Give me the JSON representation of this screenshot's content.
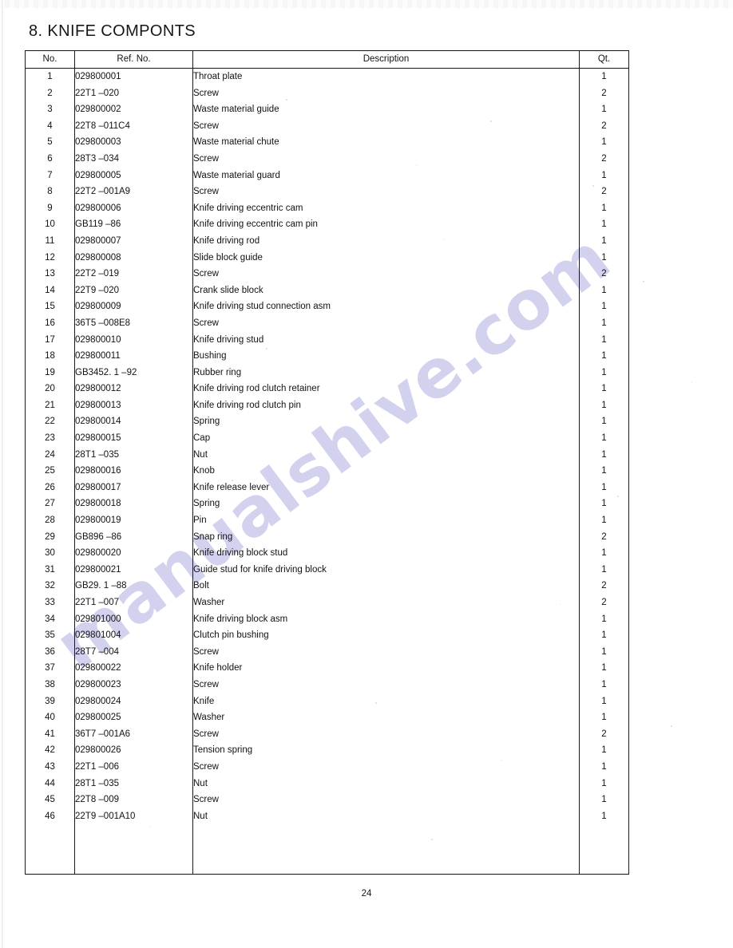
{
  "document": {
    "title": "8. KNIFE COMPONTS",
    "page_number": "24",
    "watermark": "manualshive.com",
    "watermark_color": "#c7c6ea"
  },
  "table": {
    "headers": {
      "no": "No.",
      "ref_no": "Ref. No.",
      "description": "Description",
      "qt": "Qt."
    },
    "empty_row_count": 3,
    "rows": [
      {
        "no": "1",
        "ref": "029800001",
        "desc": "Throat plate",
        "qt": "1"
      },
      {
        "no": "2",
        "ref": "22T1 –020",
        "desc": "Screw",
        "qt": "2"
      },
      {
        "no": "3",
        "ref": "029800002",
        "desc": "Waste material guide",
        "qt": "1"
      },
      {
        "no": "4",
        "ref": "22T8 –011C4",
        "desc": "Screw",
        "qt": "2"
      },
      {
        "no": "5",
        "ref": "029800003",
        "desc": "Waste material chute",
        "qt": "1"
      },
      {
        "no": "6",
        "ref": "28T3 –034",
        "desc": "Screw",
        "qt": "2"
      },
      {
        "no": "7",
        "ref": "029800005",
        "desc": "Waste material guard",
        "qt": "1"
      },
      {
        "no": "8",
        "ref": "22T2 –001A9",
        "desc": "Screw",
        "qt": "2"
      },
      {
        "no": "9",
        "ref": "029800006",
        "desc": "Knife driving eccentric cam",
        "qt": "1"
      },
      {
        "no": "10",
        "ref": "GB119 –86",
        "desc": "Knife driving eccentric cam pin",
        "qt": "1"
      },
      {
        "no": "11",
        "ref": "029800007",
        "desc": "Knife driving rod",
        "qt": "1"
      },
      {
        "no": "12",
        "ref": "029800008",
        "desc": "Slide block guide",
        "qt": "1"
      },
      {
        "no": "13",
        "ref": "22T2 –019",
        "desc": "Screw",
        "qt": "2"
      },
      {
        "no": "14",
        "ref": "22T9 –020",
        "desc": "Crank slide block",
        "qt": "1"
      },
      {
        "no": "15",
        "ref": "029800009",
        "desc": "Knife driving stud connection asm",
        "qt": "1"
      },
      {
        "no": "16",
        "ref": "36T5 –008E8",
        "desc": "Screw",
        "qt": "1"
      },
      {
        "no": "17",
        "ref": "029800010",
        "desc": "Knife driving stud",
        "qt": "1"
      },
      {
        "no": "18",
        "ref": "029800011",
        "desc": "Bushing",
        "qt": "1"
      },
      {
        "no": "19",
        "ref": "GB3452. 1 –92",
        "desc": "Rubber ring",
        "qt": "1"
      },
      {
        "no": "20",
        "ref": "029800012",
        "desc": "Knife driving rod clutch retainer",
        "qt": "1"
      },
      {
        "no": "21",
        "ref": "029800013",
        "desc": "Knife driving rod clutch pin",
        "qt": "1"
      },
      {
        "no": "22",
        "ref": "029800014",
        "desc": "Spring",
        "qt": "1"
      },
      {
        "no": "23",
        "ref": "029800015",
        "desc": "Cap",
        "qt": "1"
      },
      {
        "no": "24",
        "ref": "28T1 –035",
        "desc": "Nut",
        "qt": "1"
      },
      {
        "no": "25",
        "ref": "029800016",
        "desc": "Knob",
        "qt": "1"
      },
      {
        "no": "26",
        "ref": "029800017",
        "desc": "Knife release lever",
        "qt": "1"
      },
      {
        "no": "27",
        "ref": "029800018",
        "desc": "Spring",
        "qt": "1"
      },
      {
        "no": "28",
        "ref": "029800019",
        "desc": "Pin",
        "qt": "1"
      },
      {
        "no": "29",
        "ref": "GB896 –86",
        "desc": "Snap ring",
        "qt": "2"
      },
      {
        "no": "30",
        "ref": "029800020",
        "desc": "Knife driving block stud",
        "qt": "1"
      },
      {
        "no": "31",
        "ref": "029800021",
        "desc": "Guide stud for knife driving block",
        "qt": "1"
      },
      {
        "no": "32",
        "ref": "GB29. 1 –88",
        "desc": "Bolt",
        "qt": "2"
      },
      {
        "no": "33",
        "ref": "22T1 –007",
        "desc": "Washer",
        "qt": "2"
      },
      {
        "no": "34",
        "ref": "029801000",
        "desc": "Knife driving block asm",
        "qt": "1"
      },
      {
        "no": "35",
        "ref": "029801004",
        "desc": "Clutch pin bushing",
        "qt": "1"
      },
      {
        "no": "36",
        "ref": "28T7 –004",
        "desc": "Screw",
        "qt": "1"
      },
      {
        "no": "37",
        "ref": "029800022",
        "desc": "Knife holder",
        "qt": "1"
      },
      {
        "no": "38",
        "ref": "029800023",
        "desc": "Screw",
        "qt": "1"
      },
      {
        "no": "39",
        "ref": "029800024",
        "desc": "Knife",
        "qt": "1"
      },
      {
        "no": "40",
        "ref": "029800025",
        "desc": "Washer",
        "qt": "1"
      },
      {
        "no": "41",
        "ref": "36T7 –001A6",
        "desc": "Screw",
        "qt": "2"
      },
      {
        "no": "42",
        "ref": "029800026",
        "desc": "Tension spring",
        "qt": "1"
      },
      {
        "no": "43",
        "ref": "22T1 –006",
        "desc": "Screw",
        "qt": "1"
      },
      {
        "no": "44",
        "ref": "28T1 –035",
        "desc": "Nut",
        "qt": "1"
      },
      {
        "no": "45",
        "ref": "22T8 –009",
        "desc": "Screw",
        "qt": "1"
      },
      {
        "no": "46",
        "ref": "22T9 –001A10",
        "desc": "Nut",
        "qt": "1"
      }
    ]
  }
}
